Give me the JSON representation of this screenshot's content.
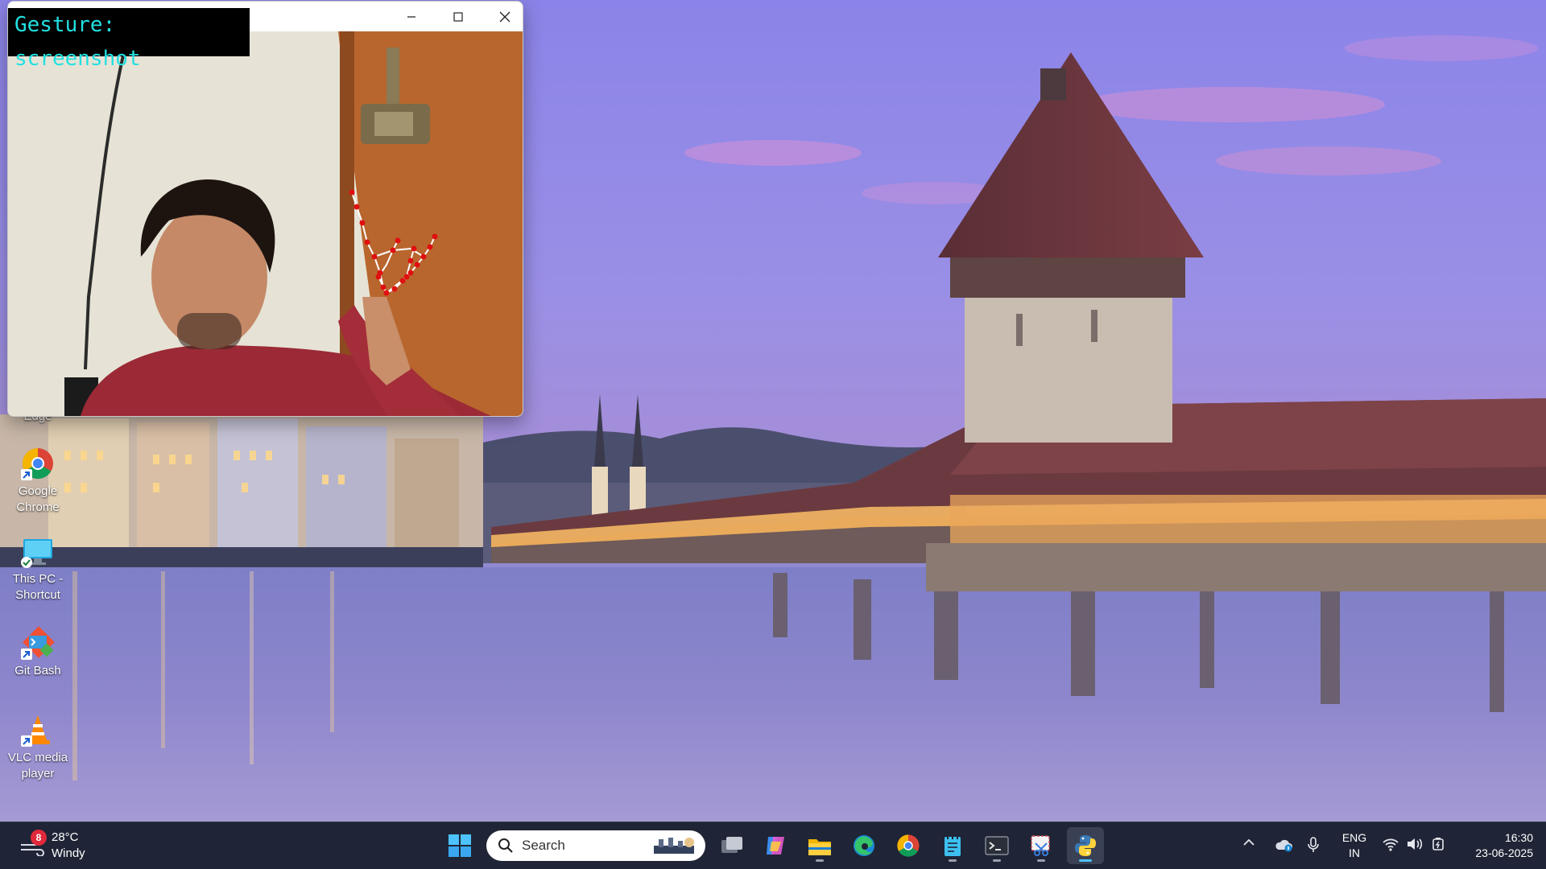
{
  "desktop": {
    "icons": [
      {
        "label": "Edge"
      },
      {
        "label": "Google Chrome"
      },
      {
        "label": "This PC - Shortcut"
      },
      {
        "label": "Git Bash"
      },
      {
        "label": "VLC media player"
      }
    ]
  },
  "camera_window": {
    "overlay_text": "Gesture: screenshot",
    "overlay_color": "#22e0e0",
    "controls": [
      "minimize-icon",
      "maximize-icon",
      "close-icon"
    ]
  },
  "taskbar": {
    "weather": {
      "temperature": "28°C",
      "condition": "Windy",
      "notification_count": "8"
    },
    "search": {
      "placeholder": "Search"
    },
    "apps": [
      {
        "name": "start-button",
        "icon": "windows-logo-icon"
      },
      {
        "name": "task-view",
        "icon": "task-view-icon"
      },
      {
        "name": "copilot",
        "icon": "copilot-icon"
      },
      {
        "name": "file-explorer",
        "icon": "folder-icon"
      },
      {
        "name": "edge",
        "icon": "edge-icon"
      },
      {
        "name": "chrome",
        "icon": "chrome-icon"
      },
      {
        "name": "notepad",
        "icon": "notepad-icon"
      },
      {
        "name": "terminal",
        "icon": "terminal-icon"
      },
      {
        "name": "snipping-tool",
        "icon": "snipping-tool-icon"
      },
      {
        "name": "python",
        "icon": "python-icon",
        "active": true
      }
    ],
    "tray": {
      "language_top": "ENG",
      "language_bottom": "IN",
      "time": "16:30",
      "date": "23-06-2025"
    },
    "accent_color": "#4cc2ff"
  }
}
